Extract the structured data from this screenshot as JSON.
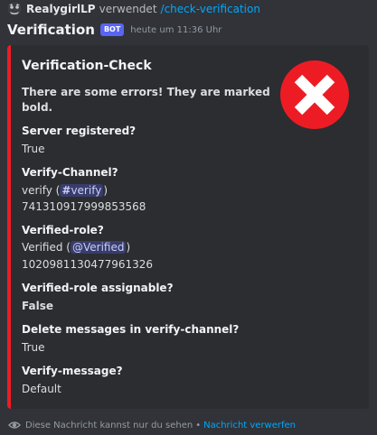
{
  "command": {
    "user": "RealygirlLP",
    "verb": "verwendet",
    "name": "/check-verification"
  },
  "author": {
    "name": "Verification",
    "tag": "BOT",
    "timestamp": "heute um 11:36 Uhr"
  },
  "embed": {
    "color": "#ed1c24",
    "title": "Verification-Check",
    "description": "There are some errors! They are marked bold.",
    "thumbnail_icon": "error-x-icon",
    "fields": {
      "server_registered": {
        "name": "Server registered?",
        "value": "True"
      },
      "verify_channel": {
        "name": "Verify-Channel?",
        "value_prefix": "verify (",
        "mention_hash": "#",
        "mention": "verify",
        "value_suffix": ")",
        "id": "741310917999853568"
      },
      "verified_role": {
        "name": "Verified-role?",
        "value_prefix": "Verified (",
        "mention": "@Verified",
        "value_suffix": ")",
        "id": "1020981130477961326"
      },
      "role_assignable": {
        "name": "Verified-role assignable?",
        "value": "False"
      },
      "delete_messages": {
        "name": "Delete messages in verify-channel?",
        "value": "True"
      },
      "verify_message": {
        "name": "Verify-message?",
        "value": "Default"
      }
    }
  },
  "ephemeral": {
    "text": "Diese Nachricht kannst nur du sehen",
    "separator": "•",
    "dismiss": "Nachricht verwerfen"
  }
}
